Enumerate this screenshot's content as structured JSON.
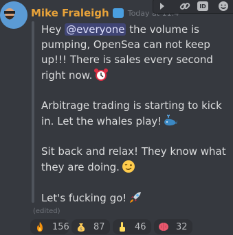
{
  "message": {
    "username": "Mike Fraleigh",
    "timestamp": "Today at 11:4",
    "line1_pre": "Hey ",
    "mention": "@everyone",
    "line1_post": " the volume is pumping, OpenSea can not keep up!!! There is sales every second right now.",
    "para2": "Arbitrage trading is starting to kick in. Let the whales play!",
    "para3": "Sit back and relax! They know what they are doing.",
    "para4": "Let's fucking go!",
    "edited": "(edited)"
  },
  "hover_toolbar": {
    "id_label": "ID"
  },
  "reactions": [
    {
      "icon": "fire-icon",
      "count": "156"
    },
    {
      "icon": "money-bag-icon",
      "count": "87"
    },
    {
      "icon": "point-up-icon",
      "count": "46"
    },
    {
      "icon": "brain-icon",
      "count": "32"
    }
  ],
  "colors": {
    "username": "#e8a33a",
    "background": "#36393f",
    "mention_bg": "#5865f2"
  }
}
